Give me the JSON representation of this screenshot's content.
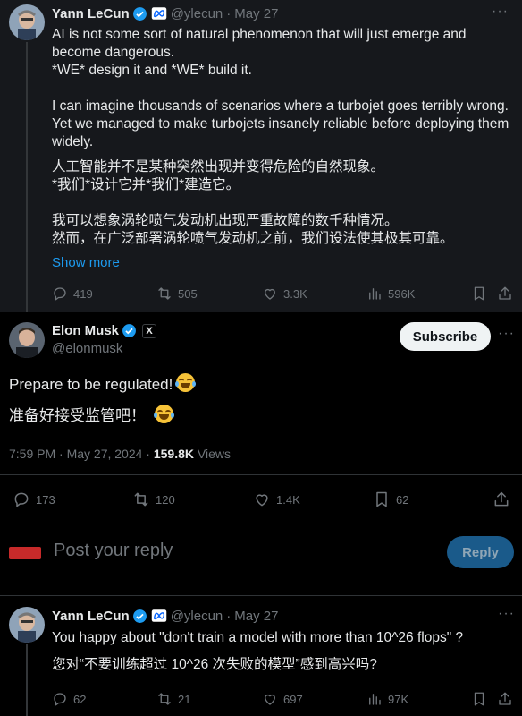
{
  "quoted": {
    "author_name": "Yann LeCun",
    "handle": "@ylecun",
    "sep": "·",
    "date": "May 27",
    "text": "AI is not some sort of natural phenomenon that will just emerge and\nbecome dangerous.\n*WE* design it and *WE* build it.\n\nI can imagine thousands of scenarios where a turbojet goes terribly wrong.\nYet we managed to make turbojets insanely reliable before deploying them\nwidely.",
    "text_zh": "人工智能并不是某种突然出现并变得危险的自然现象。\n*我们*设计它并*我们*建造它。\n\n我可以想象涡轮喷气发动机出现严重故障的数千种情况。\n然而，在广泛部署涡轮喷气发动机之前，我们设法使其极其可靠。",
    "show_more": "Show more",
    "stats": {
      "replies": "419",
      "reposts": "505",
      "likes": "3.3K",
      "views": "596K"
    }
  },
  "main": {
    "author_name": "Elon Musk",
    "handle": "@elonmusk",
    "affiliate_badge": "X",
    "subscribe_label": "Subscribe",
    "text": "Prepare to be regulated!",
    "text_zh": "准备好接受监管吧！",
    "timestamp": "7:59 PM · May 27, 2024 · ",
    "views_count": "159.8K",
    "views_label": "Views",
    "stats": {
      "replies": "173",
      "reposts": "120",
      "likes": "1.4K",
      "bookmarks": "62"
    }
  },
  "composer": {
    "placeholder": "Post your reply",
    "reply_label": "Reply"
  },
  "reply": {
    "author_name": "Yann LeCun",
    "handle": "@ylecun",
    "sep": "·",
    "date": "May 27",
    "text": "You happy about \"don't train a model with more than 10^26 flops\" ?",
    "text_zh": "您对“不要训练超过 10^26 次失败的模型”感到高兴吗?",
    "stats": {
      "replies": "62",
      "reposts": "21",
      "likes": "697",
      "views": "97K"
    }
  },
  "icons": [
    "more-icon",
    "verified-icon",
    "meta-affiliate-icon",
    "reply-icon",
    "repost-icon",
    "like-icon",
    "views-icon",
    "bookmark-icon",
    "share-icon",
    "x-affiliate-icon",
    "laughing-emoji"
  ],
  "colors": {
    "accent": "#1d9bf0",
    "background": "#000000",
    "quoted_bg": "#16181c",
    "muted": "#71767b",
    "text": "#e7e9ea"
  }
}
